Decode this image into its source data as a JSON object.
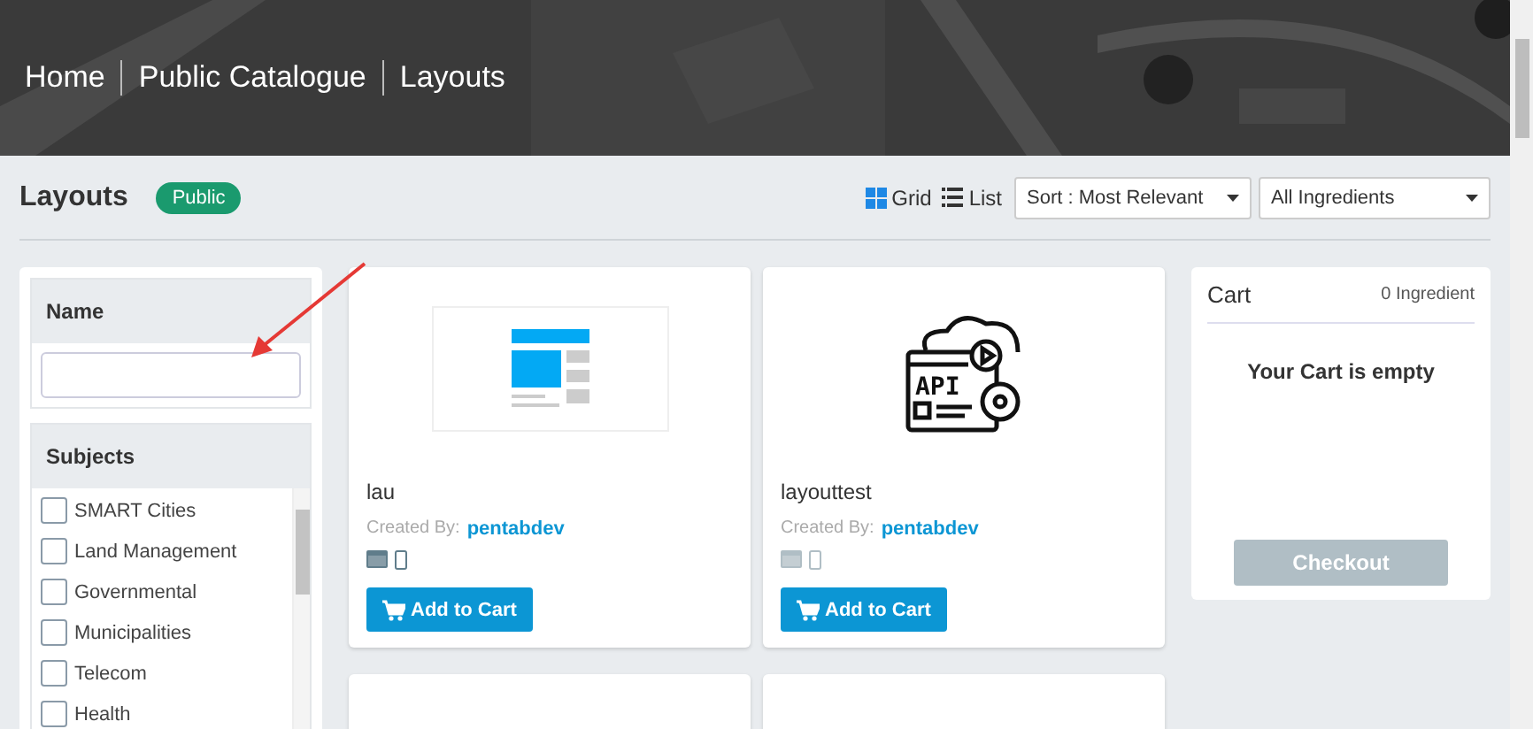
{
  "breadcrumb": [
    {
      "label": "Home"
    },
    {
      "label": "Public Catalogue"
    },
    {
      "label": "Layouts"
    }
  ],
  "page": {
    "title": "Layouts",
    "badge": "Public"
  },
  "view_toggle": [
    {
      "label": "Grid",
      "kind": "grid",
      "selected": true
    },
    {
      "label": "List",
      "kind": "list",
      "selected": false
    }
  ],
  "sort_select": {
    "value": "Sort : Most Relevant"
  },
  "ingredient_select": {
    "value": "All Ingredients"
  },
  "filters": {
    "name": {
      "title": "Name"
    },
    "subjects": {
      "title": "Subjects",
      "items": [
        {
          "label": "SMART Cities",
          "checked": false
        },
        {
          "label": "Land Management",
          "checked": false
        },
        {
          "label": "Governmental",
          "checked": false
        },
        {
          "label": "Municipalities",
          "checked": false
        },
        {
          "label": "Telecom",
          "checked": false
        },
        {
          "label": "Health",
          "checked": false
        }
      ]
    }
  },
  "cards": [
    {
      "kind": "layout",
      "title": "lau",
      "created_label": "Created By:",
      "author": "pentabdev",
      "desktop": true,
      "mobile": true,
      "button": "Add to Cart"
    },
    {
      "kind": "api",
      "icon_text": "API",
      "title": "layouttest",
      "created_label": "Created By:",
      "author": "pentabdev",
      "desktop": false,
      "mobile": false,
      "button": "Add to Cart"
    },
    {
      "kind": "partial"
    },
    {
      "kind": "partial"
    }
  ],
  "cart": {
    "title": "Cart",
    "count": "0 Ingredient",
    "message": "Your Cart is empty",
    "checkout": "Checkout",
    "checkout_disabled": true
  }
}
